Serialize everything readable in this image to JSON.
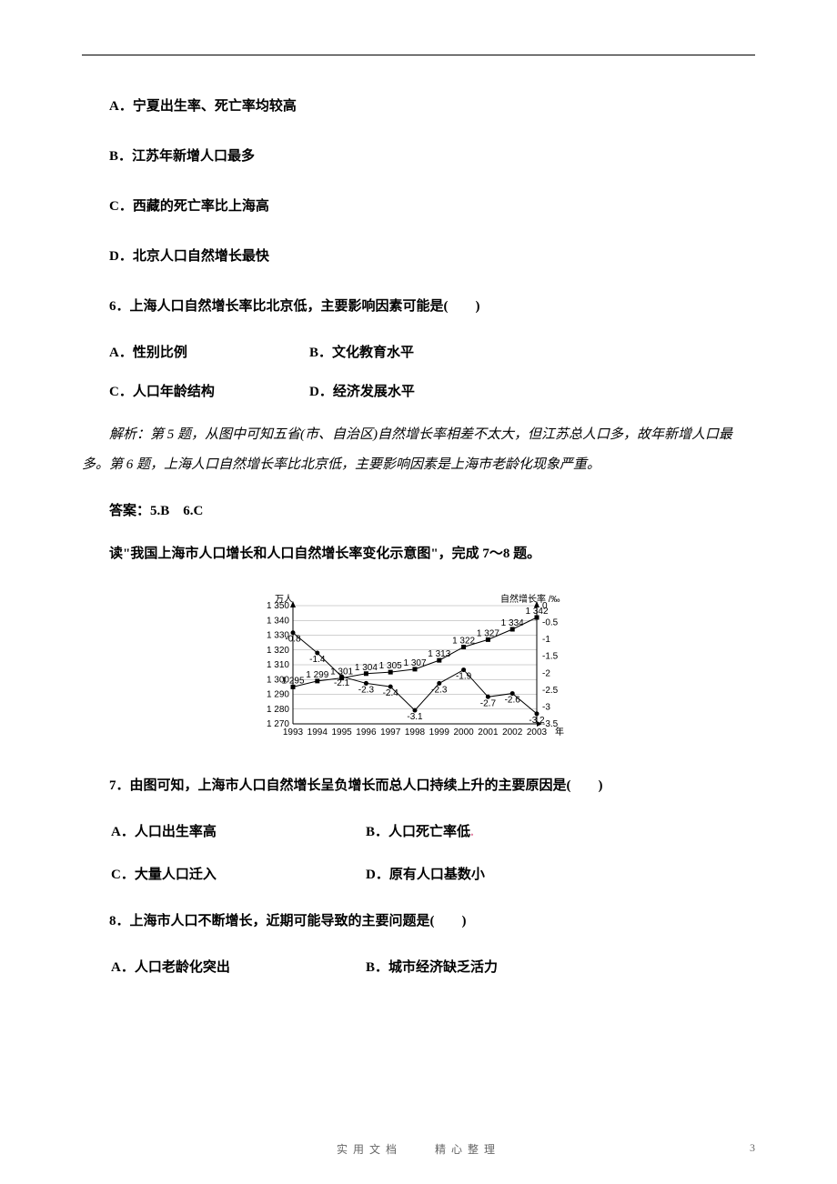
{
  "q5_options": {
    "a": "A．宁夏出生率、死亡率均较高",
    "b": "B．江苏年新增人口最多",
    "c": "C．西藏的死亡率比上海高",
    "d": "D．北京人口自然增长最快"
  },
  "q6": {
    "stem": "6．上海人口自然增长率比北京低，主要影响因素可能是(　　)",
    "a": "A．性别比例",
    "b": "B．文化教育水平",
    "c": "C．人口年龄结构",
    "d": "D．经济发展水平"
  },
  "explanation_56": "解析：第 5 题，从图中可知五省(市、自治区)自然增长率相差不太大，但江苏总人口多，故年新增人口最多。第 6 题，上海人口自然增长率比北京低，主要影响因素是上海市老龄化现象严重。",
  "answer_56": "答案：5.B　6.C",
  "intro78": "读\"我国上海市人口增长和人口自然增长率变化示意图\"，完成 7～8 题。",
  "chart_data": {
    "type": "line",
    "y1label": "万人",
    "y2label": "自然增长率 /‰",
    "xlabel": "年",
    "x": [
      1993,
      1994,
      1995,
      1996,
      1997,
      1998,
      1999,
      2000,
      2001,
      2002,
      2003
    ],
    "y1_ticks": [
      1270,
      1280,
      1290,
      1300,
      1310,
      1320,
      1330,
      1340,
      1350
    ],
    "y2_ticks": [
      0,
      -0.5,
      -1,
      -1.5,
      -2,
      -2.5,
      -3,
      -3.5
    ],
    "series": [
      {
        "name": "人口(万人)",
        "axis": "y1",
        "marker": "square",
        "values": [
          1295,
          1299,
          1301,
          1304,
          1305,
          1307,
          1313,
          1322,
          1327,
          1334,
          1342
        ],
        "labels": [
          "1 295",
          "1 299",
          "1 301",
          "1 304",
          "1 305",
          "1 307",
          "1 313",
          "1 322",
          "1 327",
          "1 334",
          "1 342"
        ]
      },
      {
        "name": "自然增长率(‰)",
        "axis": "y2",
        "marker": "circle",
        "values": [
          -0.8,
          -1.4,
          -2.1,
          -2.3,
          -2.4,
          -3.1,
          -2.3,
          -1.9,
          -2.7,
          -2.6,
          -3.2
        ],
        "labels": [
          "-0.8",
          "-1.4",
          "-2.1",
          "-2.3",
          "-2.4",
          "-3.1",
          "-2.3",
          "-1.9",
          "-2.7",
          "-2.6",
          "-3.2"
        ]
      }
    ]
  },
  "q7": {
    "stem": "7．由图可知，上海市人口自然增长呈负增长而总人口持续上升的主要原因是(　　)",
    "a": "A．人口出生率高",
    "b": "B．人口死亡率低",
    "c": "C．大量人口迁入",
    "d": "D．原有人口基数小"
  },
  "q8": {
    "stem": "8．上海市人口不断增长，近期可能导致的主要问题是(　　)",
    "a": "A．人口老龄化突出",
    "b": "B．城市经济缺乏活力"
  },
  "footer": {
    "center": "实用文档　　精心整理",
    "page": "3"
  }
}
